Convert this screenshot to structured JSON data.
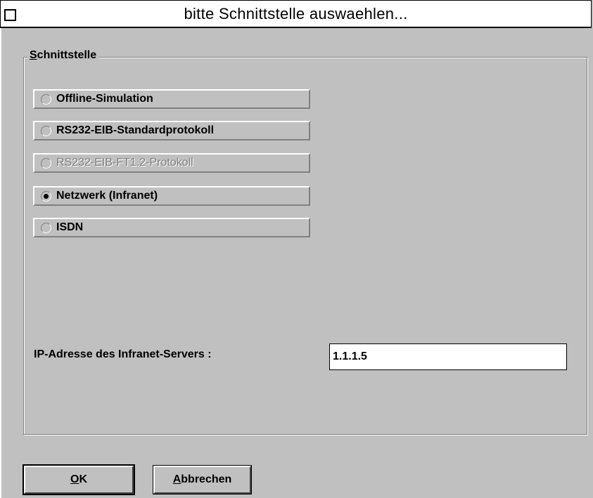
{
  "window": {
    "title": "bitte Schnittstelle auswaehlen..."
  },
  "group": {
    "legend_mnemonic": "S",
    "legend_rest": "chnittstelle"
  },
  "options": [
    {
      "label": "Offline-Simulation",
      "checked": false,
      "enabled": true
    },
    {
      "label": "RS232-EIB-Standardprotokoll",
      "checked": false,
      "enabled": true
    },
    {
      "label": "RS232-EIB-FT1.2-Protokoll",
      "checked": false,
      "enabled": false
    },
    {
      "label": "Netzwerk (Infranet)",
      "checked": true,
      "enabled": true
    },
    {
      "label": "ISDN",
      "checked": false,
      "enabled": true
    }
  ],
  "ip": {
    "label": "IP-Adresse des Infranet-Servers :",
    "value": "1.1.1.5"
  },
  "buttons": {
    "ok_mnemonic": "O",
    "ok_rest": "K",
    "cancel_mnemonic": "A",
    "cancel_rest": "bbrechen"
  }
}
